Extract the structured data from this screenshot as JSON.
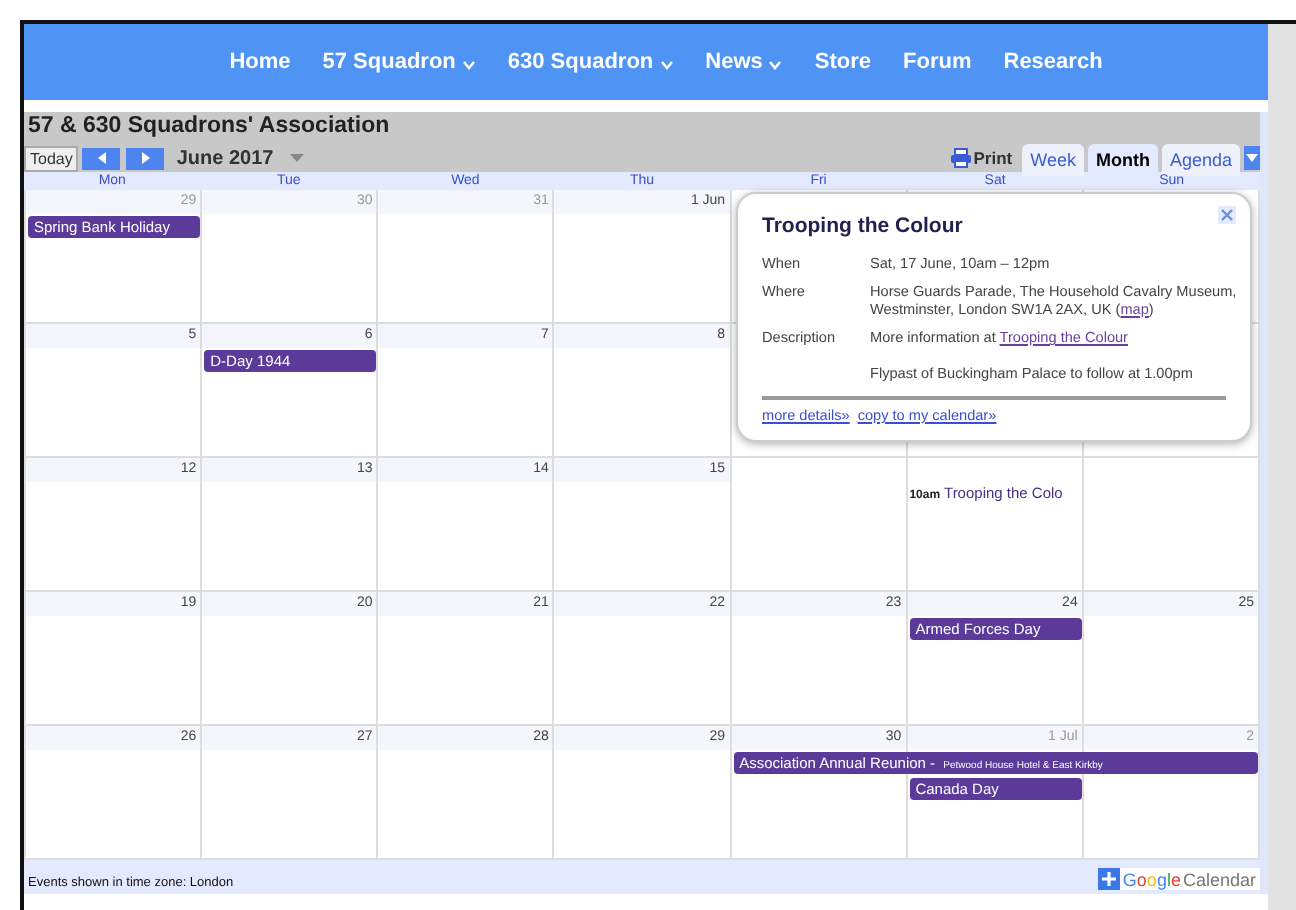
{
  "nav": {
    "items": [
      {
        "label": "Home",
        "has_menu": false
      },
      {
        "label": "57 Squadron",
        "has_menu": true
      },
      {
        "label": "630 Squadron",
        "has_menu": true
      },
      {
        "label": "News",
        "has_menu": true
      },
      {
        "label": "Store",
        "has_menu": false
      },
      {
        "label": "Forum",
        "has_menu": false
      },
      {
        "label": "Research",
        "has_menu": false
      }
    ]
  },
  "calendar": {
    "title": "57 & 630 Squadrons' Association",
    "today_button": "Today",
    "month_label": "June 2017",
    "print_label": "Print",
    "views": [
      {
        "label": "Week",
        "selected": false
      },
      {
        "label": "Month",
        "selected": true
      },
      {
        "label": "Agenda",
        "selected": false
      }
    ],
    "weekdays": [
      "Mon",
      "Tue",
      "Wed",
      "Thu",
      "Fri",
      "Sat",
      "Sun"
    ],
    "weeks": [
      {
        "days": [
          {
            "date": "29",
            "other_month": true
          },
          {
            "date": "30",
            "other_month": true
          },
          {
            "date": "31",
            "other_month": true
          },
          {
            "date": "1 Jun",
            "other_month": false
          }
        ],
        "events": {
          "mon": [
            {
              "kind": "chip",
              "title": "Spring Bank Holiday",
              "runs_to_week_end": false
            }
          ]
        }
      },
      {
        "days": [
          {
            "date": "5",
            "other_month": false
          },
          {
            "date": "6",
            "other_month": false
          },
          {
            "date": "7",
            "other_month": false
          },
          {
            "date": "8",
            "other_month": false
          }
        ],
        "events": {
          "tue": [
            {
              "kind": "chip",
              "title": "D-Day 1944",
              "runs_to_week_end": false
            }
          ]
        }
      },
      {
        "days": [
          {
            "date": "12",
            "other_month": false
          },
          {
            "date": "13",
            "other_month": false
          },
          {
            "date": "14",
            "other_month": false
          },
          {
            "date": "15",
            "other_month": false
          }
        ],
        "events": {
          "sat": [
            {
              "kind": "timed",
              "time": "10am",
              "title": "Trooping the Colo"
            }
          ]
        }
      },
      {
        "days": [
          {
            "date": "19",
            "other_month": false
          },
          {
            "date": "20",
            "other_month": false
          },
          {
            "date": "21",
            "other_month": false
          },
          {
            "date": "22",
            "other_month": false
          },
          {
            "date": "23",
            "other_month": false
          },
          {
            "date": "24",
            "other_month": false
          },
          {
            "date": "25",
            "other_month": false
          }
        ],
        "events": {
          "sat": [
            {
              "kind": "chip",
              "title": "Armed Forces Day",
              "runs_to_week_end": false
            }
          ]
        }
      },
      {
        "days": [
          {
            "date": "26",
            "other_month": false
          },
          {
            "date": "27",
            "other_month": false
          },
          {
            "date": "28",
            "other_month": false
          },
          {
            "date": "29",
            "other_month": false
          },
          {
            "date": "30",
            "other_month": false
          },
          {
            "date": "1 Jul",
            "other_month": true
          },
          {
            "date": "2",
            "other_month": true
          }
        ],
        "events": {
          "fri": [
            {
              "kind": "chip",
              "title": "Association Annual Reunion - ",
              "subtitle": "Petwood House Hotel & East Kirkby",
              "runs_to_week_end": true
            }
          ],
          "sat": [
            {
              "kind": "chip",
              "title": "Canada Day",
              "runs_to_week_end": false
            }
          ]
        }
      }
    ],
    "footer": {
      "timezone": "Events shown in time zone: London",
      "badge": "Google",
      "badge_suffix": "Calendar"
    }
  },
  "popup": {
    "title": "Trooping the Colour",
    "fields": [
      {
        "label": "When",
        "parts": [
          {
            "kind": "text",
            "text": "Sat, 17 June, 10am – 12pm"
          }
        ]
      },
      {
        "label": "Where",
        "parts": [
          {
            "kind": "text",
            "text": "Horse Guards Parade, The Household Cavalry Museum, Westminster, London SW1A 2AX, UK "
          },
          {
            "kind": "text",
            "text": "("
          },
          {
            "kind": "link",
            "text": "map"
          },
          {
            "kind": "text",
            "text": ")"
          }
        ]
      },
      {
        "label": "Description",
        "parts": [
          {
            "kind": "text",
            "text": "More information at "
          },
          {
            "kind": "link",
            "text": "Trooping the Colour"
          }
        ],
        "note": "Flypast of Buckingham Palace to follow at 1.00pm"
      }
    ],
    "links": [
      "more details»",
      "copy to my calendar»"
    ]
  }
}
